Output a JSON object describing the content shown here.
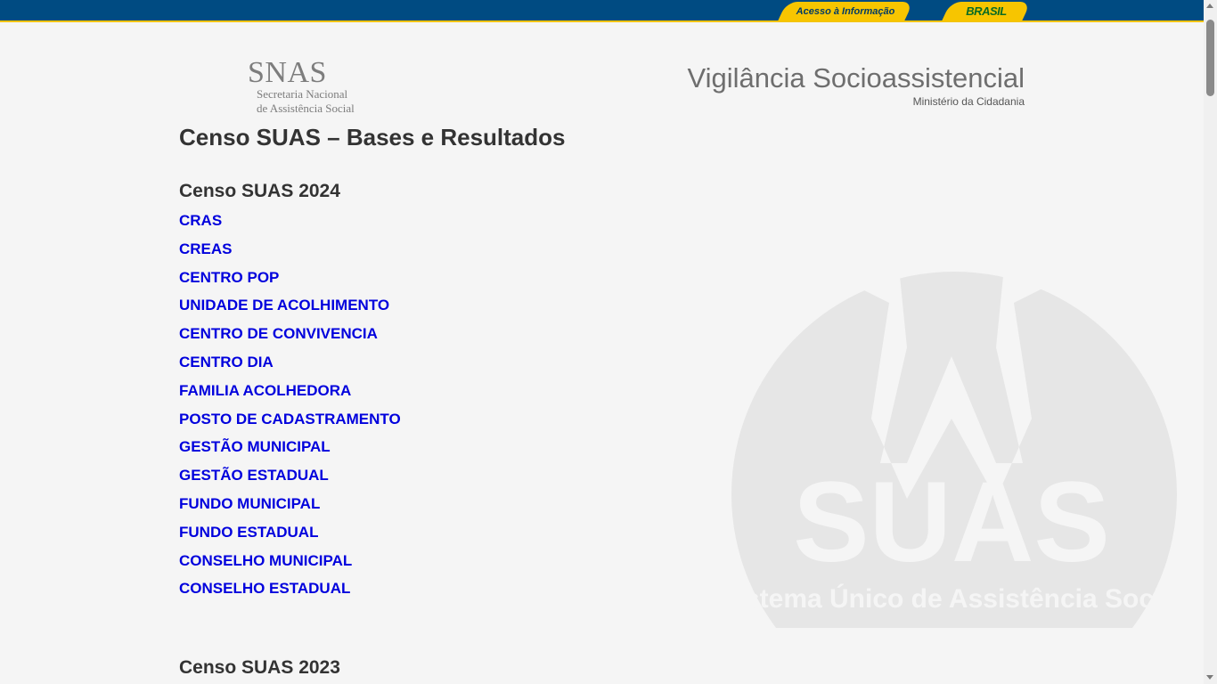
{
  "gov_bar": {
    "access_info": "Acesso à Informação",
    "brasil": "BRASIL"
  },
  "header": {
    "logo_abbr": "SNAS",
    "logo_line1": "Secretaria Nacional",
    "logo_line2": "de Assistência Social",
    "site_title": "Vigilância Socioassistencial",
    "site_subtitle": "Ministério da Cidadania"
  },
  "main": {
    "page_title": "Censo SUAS – Bases e Resultados",
    "sections": [
      {
        "heading": "Censo SUAS 2024",
        "links": [
          "CRAS",
          "CREAS",
          "CENTRO POP",
          "UNIDADE DE ACOLHIMENTO",
          "CENTRO DE CONVIVENCIA",
          "CENTRO DIA",
          "FAMILIA ACOLHEDORA",
          "POSTO DE CADASTRAMENTO",
          "GESTÃO MUNICIPAL",
          "GESTÃO ESTADUAL",
          "FUNDO MUNICIPAL",
          "FUNDO ESTADUAL",
          "CONSELHO MUNICIPAL",
          "CONSELHO ESTADUAL"
        ]
      },
      {
        "heading": "Censo SUAS 2023",
        "links": []
      }
    ]
  },
  "watermark": {
    "big": "SUAS",
    "caption": "Sistema Único de Assistência Social"
  },
  "colors": {
    "gov_blue": "#004b82",
    "gov_yellow": "#f7c500",
    "link_blue": "#0000dd",
    "background": "#f5f5f5"
  },
  "icons": [
    "scroll-up-arrow-icon",
    "scroll-down-arrow-icon"
  ]
}
